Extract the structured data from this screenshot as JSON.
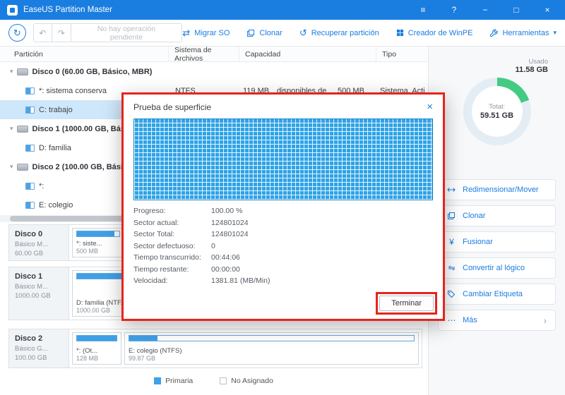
{
  "titlebar": {
    "title": "EaseUS Partition Master",
    "menu": "≡",
    "help": "?",
    "minimize": "−",
    "maximize": "□",
    "close": "×"
  },
  "glyphs": {
    "refresh": "↻",
    "undo": "↶",
    "redo": "↷",
    "migrate": "⇄",
    "recover": "↺",
    "caret_down": "▾",
    "chevron_down": "▾",
    "merge": "¥",
    "convert": "⇋",
    "more_dots": "⋯",
    "more_chevron": "›",
    "dialog_close": "×"
  },
  "toolbar": {
    "pending": "No hay operación pendiente",
    "migrate": "Migrar SO",
    "clone": "Clonar",
    "recover": "Recuperar partición",
    "winpe": "Creador de WinPE",
    "tools": "Herramientas"
  },
  "table": {
    "col_partition": "Partición",
    "col_fs": "Sistema de Archivos",
    "col_capacity": "Capacidad",
    "col_type": "Tipo"
  },
  "tree": {
    "rows": [
      {
        "kind": "disk",
        "label": "Disco 0 (60.00 GB, Básico, MBR)"
      },
      {
        "kind": "part",
        "label": "*: sistema conserva",
        "fs": "NTFS",
        "cap": "119 MB",
        "cap_extra": "disponibles de",
        "cap_total": "500 MB",
        "tipo": "Sistema, Acti..."
      },
      {
        "kind": "part",
        "label": "C: trabajo"
      },
      {
        "kind": "disk",
        "label": "Disco 1 (1000.00 GB, Básico, M..."
      },
      {
        "kind": "part",
        "label": "D: familia"
      },
      {
        "kind": "disk",
        "label": "Disco 2 (100.00 GB, Básico, G..."
      },
      {
        "kind": "part",
        "label": "*:"
      },
      {
        "kind": "part",
        "label": "E: colegio"
      }
    ]
  },
  "dialog": {
    "title": "Prueba de superficie",
    "rows": [
      {
        "label": "Progreso:",
        "value": "100.00 %"
      },
      {
        "label": "Sector actual:",
        "value": "124801024"
      },
      {
        "label": "Sector Total:",
        "value": "124801024"
      },
      {
        "label": "Sector defectuoso:",
        "value": "0"
      },
      {
        "label": "Tiempo transcurrido:",
        "value": "00:44:06"
      },
      {
        "label": "Tiempo restante:",
        "value": "00:00:00"
      },
      {
        "label": "Velocidad:",
        "value": "1381.81 (MB/Min)"
      }
    ],
    "finish": "Terminar"
  },
  "sidebar": {
    "used_label": "Usado",
    "used_value": "11.58 GB",
    "total_label": "Total:",
    "total_value": "59.51 GB",
    "actions": [
      {
        "label": "Redimensionar/Mover"
      },
      {
        "label": "Clonar"
      },
      {
        "label": "Fusionar"
      },
      {
        "label": "Convertir al lógico"
      },
      {
        "label": "Cambiar Etiqueta"
      },
      {
        "label": "Más"
      }
    ]
  },
  "panels": [
    {
      "name": "Disco 0",
      "kind": "Básico M...",
      "size": "60.00 GB",
      "parts": [
        {
          "label": "*: siste...",
          "size": "500 MB"
        },
        {
          "label": "",
          "size": ""
        }
      ]
    },
    {
      "name": "Disco 1",
      "kind": "Básico M...",
      "size": "1000.00 GB",
      "parts": [
        {
          "label": "D: familia (NTF...",
          "size": "1000.00 GB"
        }
      ]
    },
    {
      "name": "Disco 2",
      "kind": "Básico G...",
      "size": "100.00 GB",
      "parts": [
        {
          "label": "*: (Ot...",
          "size": "128 MB"
        },
        {
          "label": "E: colegio (NTFS)",
          "size": "99.87 GB"
        }
      ]
    }
  ],
  "legend": {
    "primary": "Primaria",
    "unallocated": "No Asignado"
  },
  "colors": {
    "accent": "#1a7de0",
    "green": "#43cb83",
    "grid_blue": "#2ea3e6",
    "annotation_red": "#e8231d",
    "selected_row": "#cfe7fa"
  }
}
